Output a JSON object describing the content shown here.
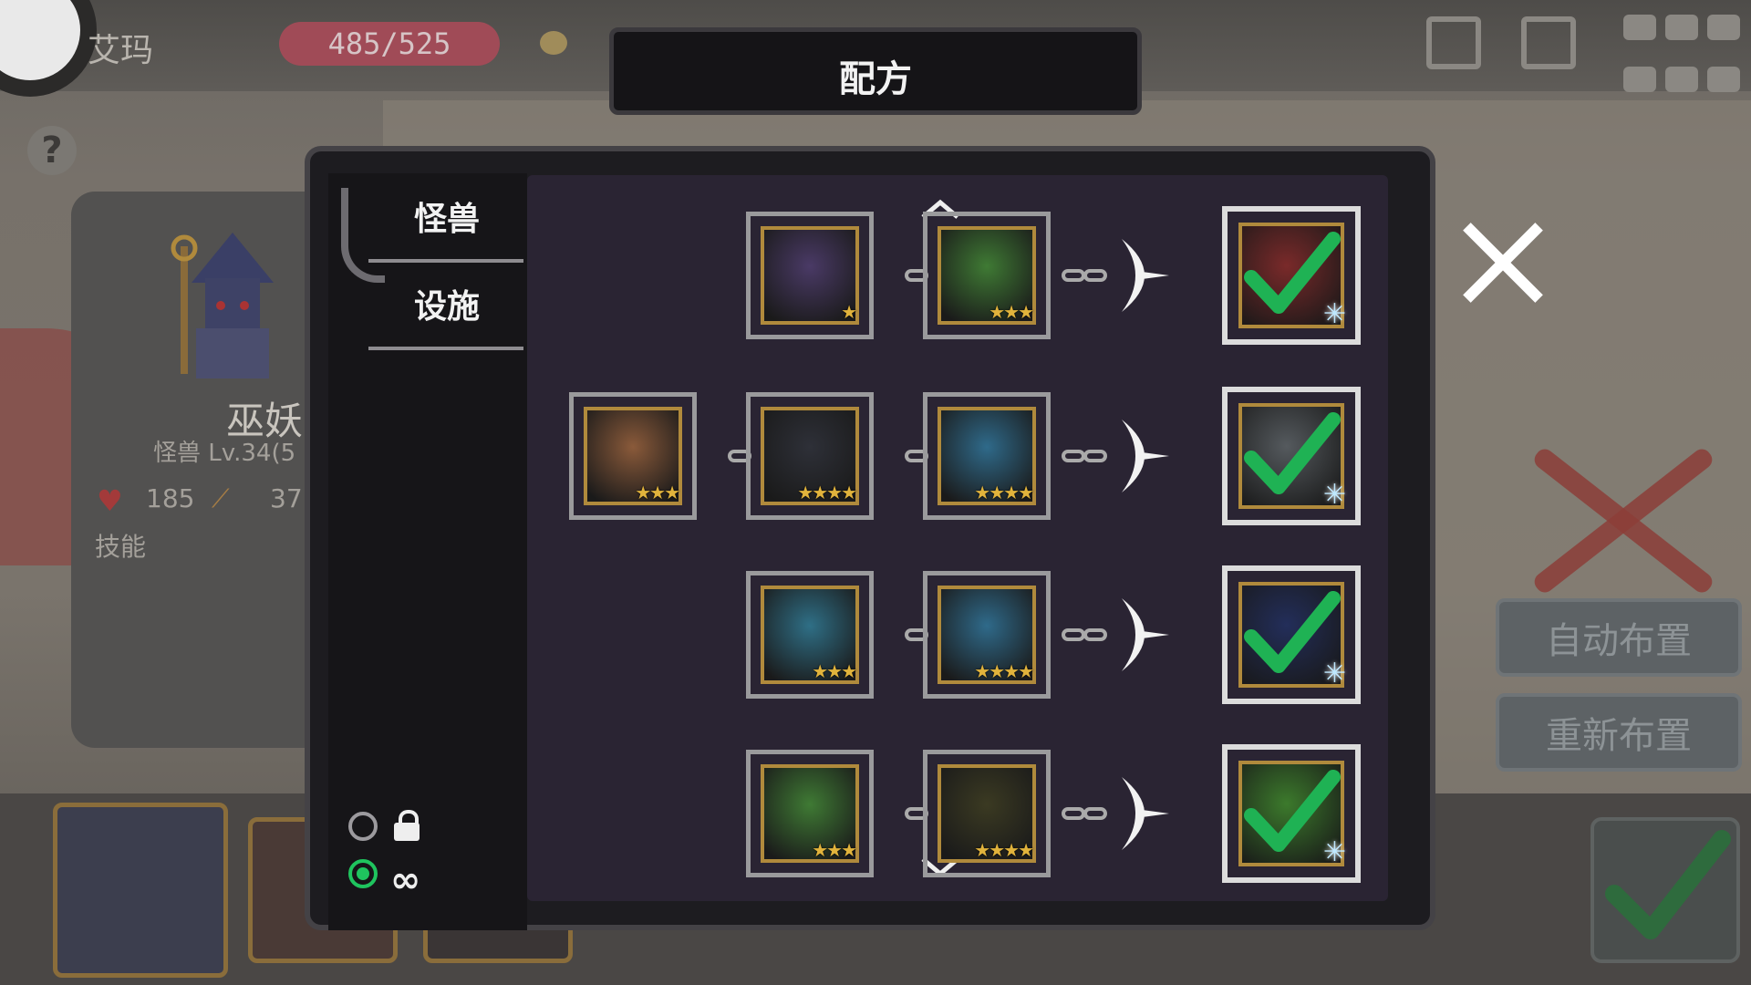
{
  "header": {
    "player_name": "艾玛",
    "hp": "485/525",
    "dialog_title": "配方"
  },
  "monster_card": {
    "name": "巫妖",
    "subtitle": "怪兽 Lv.34(5",
    "hp": "185",
    "atk": "37",
    "skills_label": "技能"
  },
  "side_buttons": {
    "auto_arrange": "自动布置",
    "rearrange": "重新布置"
  },
  "tabs": [
    {
      "label": "怪兽"
    },
    {
      "label": "设施"
    }
  ],
  "options": [
    {
      "icon": "lock-icon",
      "selected": false
    },
    {
      "icon": "infinity-icon",
      "selected": true
    }
  ],
  "recipes": [
    {
      "ingredients": [
        {
          "name": "purple-bat-demon",
          "color": "#4a3a66",
          "stars": "★"
        },
        {
          "name": "green-dryad",
          "color": "#3f7a34",
          "stars": "★★★"
        }
      ],
      "result": {
        "name": "red-haired-fairy",
        "color": "#7a2a2a",
        "crafted": true
      }
    },
    {
      "ingredients": [
        {
          "name": "white-haired-girl",
          "color": "#8a5a3a",
          "stars": "★★★"
        },
        {
          "name": "dark-werewolf",
          "color": "#2e3038",
          "stars": "★★★★"
        },
        {
          "name": "blue-golem",
          "color": "#2f6a8a",
          "stars": "★★★★"
        }
      ],
      "result": {
        "name": "grey-wolf-beast",
        "color": "#555a5e",
        "crafted": true
      }
    },
    {
      "ingredients": [
        {
          "name": "blue-slime-girl",
          "color": "#2f6f86",
          "stars": "★★★"
        },
        {
          "name": "blue-golem",
          "color": "#2f6a8a",
          "stars": "★★★★"
        }
      ],
      "result": {
        "name": "dark-blue-knight",
        "color": "#232e5a",
        "crafted": true
      }
    },
    {
      "ingredients": [
        {
          "name": "green-dryad",
          "color": "#3f7a34",
          "stars": "★★★"
        },
        {
          "name": "tree-ent",
          "color": "#3b3a22",
          "stars": "★★★★"
        }
      ],
      "result": {
        "name": "green-nymph",
        "color": "#3c7a2c",
        "crafted": true
      }
    }
  ],
  "colors": {
    "check": "#1fb254",
    "selected_radio": "#1fc45e",
    "hp_bar": "#a04b57"
  }
}
